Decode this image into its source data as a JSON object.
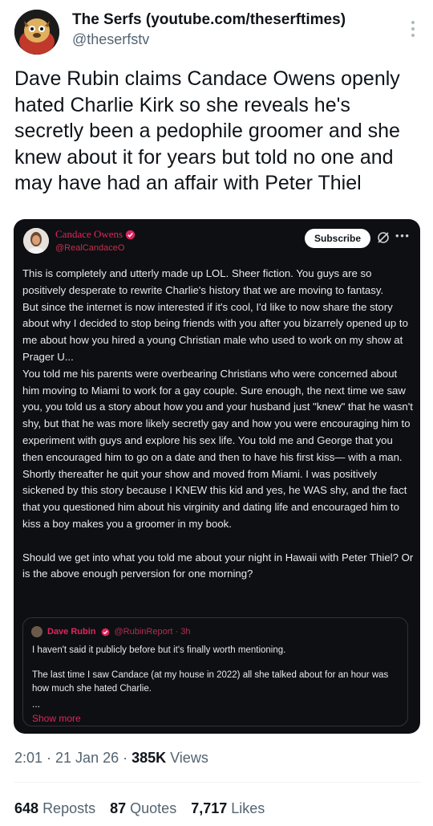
{
  "author": {
    "name": "The Serfs (youtube.com/theserftimes)",
    "handle": "@theserfstv"
  },
  "tweet": {
    "text": "Dave Rubin claims Candace Owens openly hated Charlie Kirk so she reveals he's secretly been a pedophile groomer and she knew about it for years but told no one and may have had an affair with Peter Thiel"
  },
  "embedded_post": {
    "name": "Candace Owens",
    "handle": "@RealCandaceO",
    "subscribe_label": "Subscribe",
    "paragraphs": [
      "This is completely and utterly made up LOL. Sheer fiction. You guys are so positively desperate to rewrite Charlie's history that we are moving to fantasy.",
      "But since the internet is now interested if it's cool, I'd like to now share the story about why I decided to stop being friends with you after you bizarrely opened up to me about how you hired a young Christian male who used to work on my show at Prager U...",
      "You told me his parents were overbearing Christians who were concerned about him moving to Miami to work for a gay couple. Sure enough, the next time we saw you, you told us a story about how you and your husband just \"knew\" that he wasn't shy, but that he was more likely secretly gay and how you were encouraging him to experiment with guys and explore his sex life. You told me and George that you then encouraged him to go on a date and then to have his first kiss— with a man.",
      "Shortly thereafter he quit your show and moved from Miami. I was positively sickened by this story because I KNEW this kid and yes, he WAS shy, and the fact that you questioned him about his virginity and dating life and encouraged him to kiss a boy makes you a groomer in my book.",
      "Should we get into what you told me about your night in Hawaii with Peter Thiel? Or is the above enough perversion for one morning?"
    ],
    "quote": {
      "name": "Dave Rubin",
      "meta": "@RubinReport · 3h",
      "line1": "I haven't said it publicly before but it's finally worth mentioning.",
      "line2": "The last time I saw Candace (at my house in 2022) all she talked about for an hour was how much she hated Charlie.",
      "ellipsis": "...",
      "show_more": "Show more"
    }
  },
  "meta": {
    "time": "2:01 · 21 Jan 26 · ",
    "views_count": "385K",
    "views_label": " Views"
  },
  "stats": {
    "reposts_count": "648",
    "reposts_label": "Reposts",
    "quotes_count": "87",
    "quotes_label": "Quotes",
    "likes_count": "7,717",
    "likes_label": "Likes"
  }
}
